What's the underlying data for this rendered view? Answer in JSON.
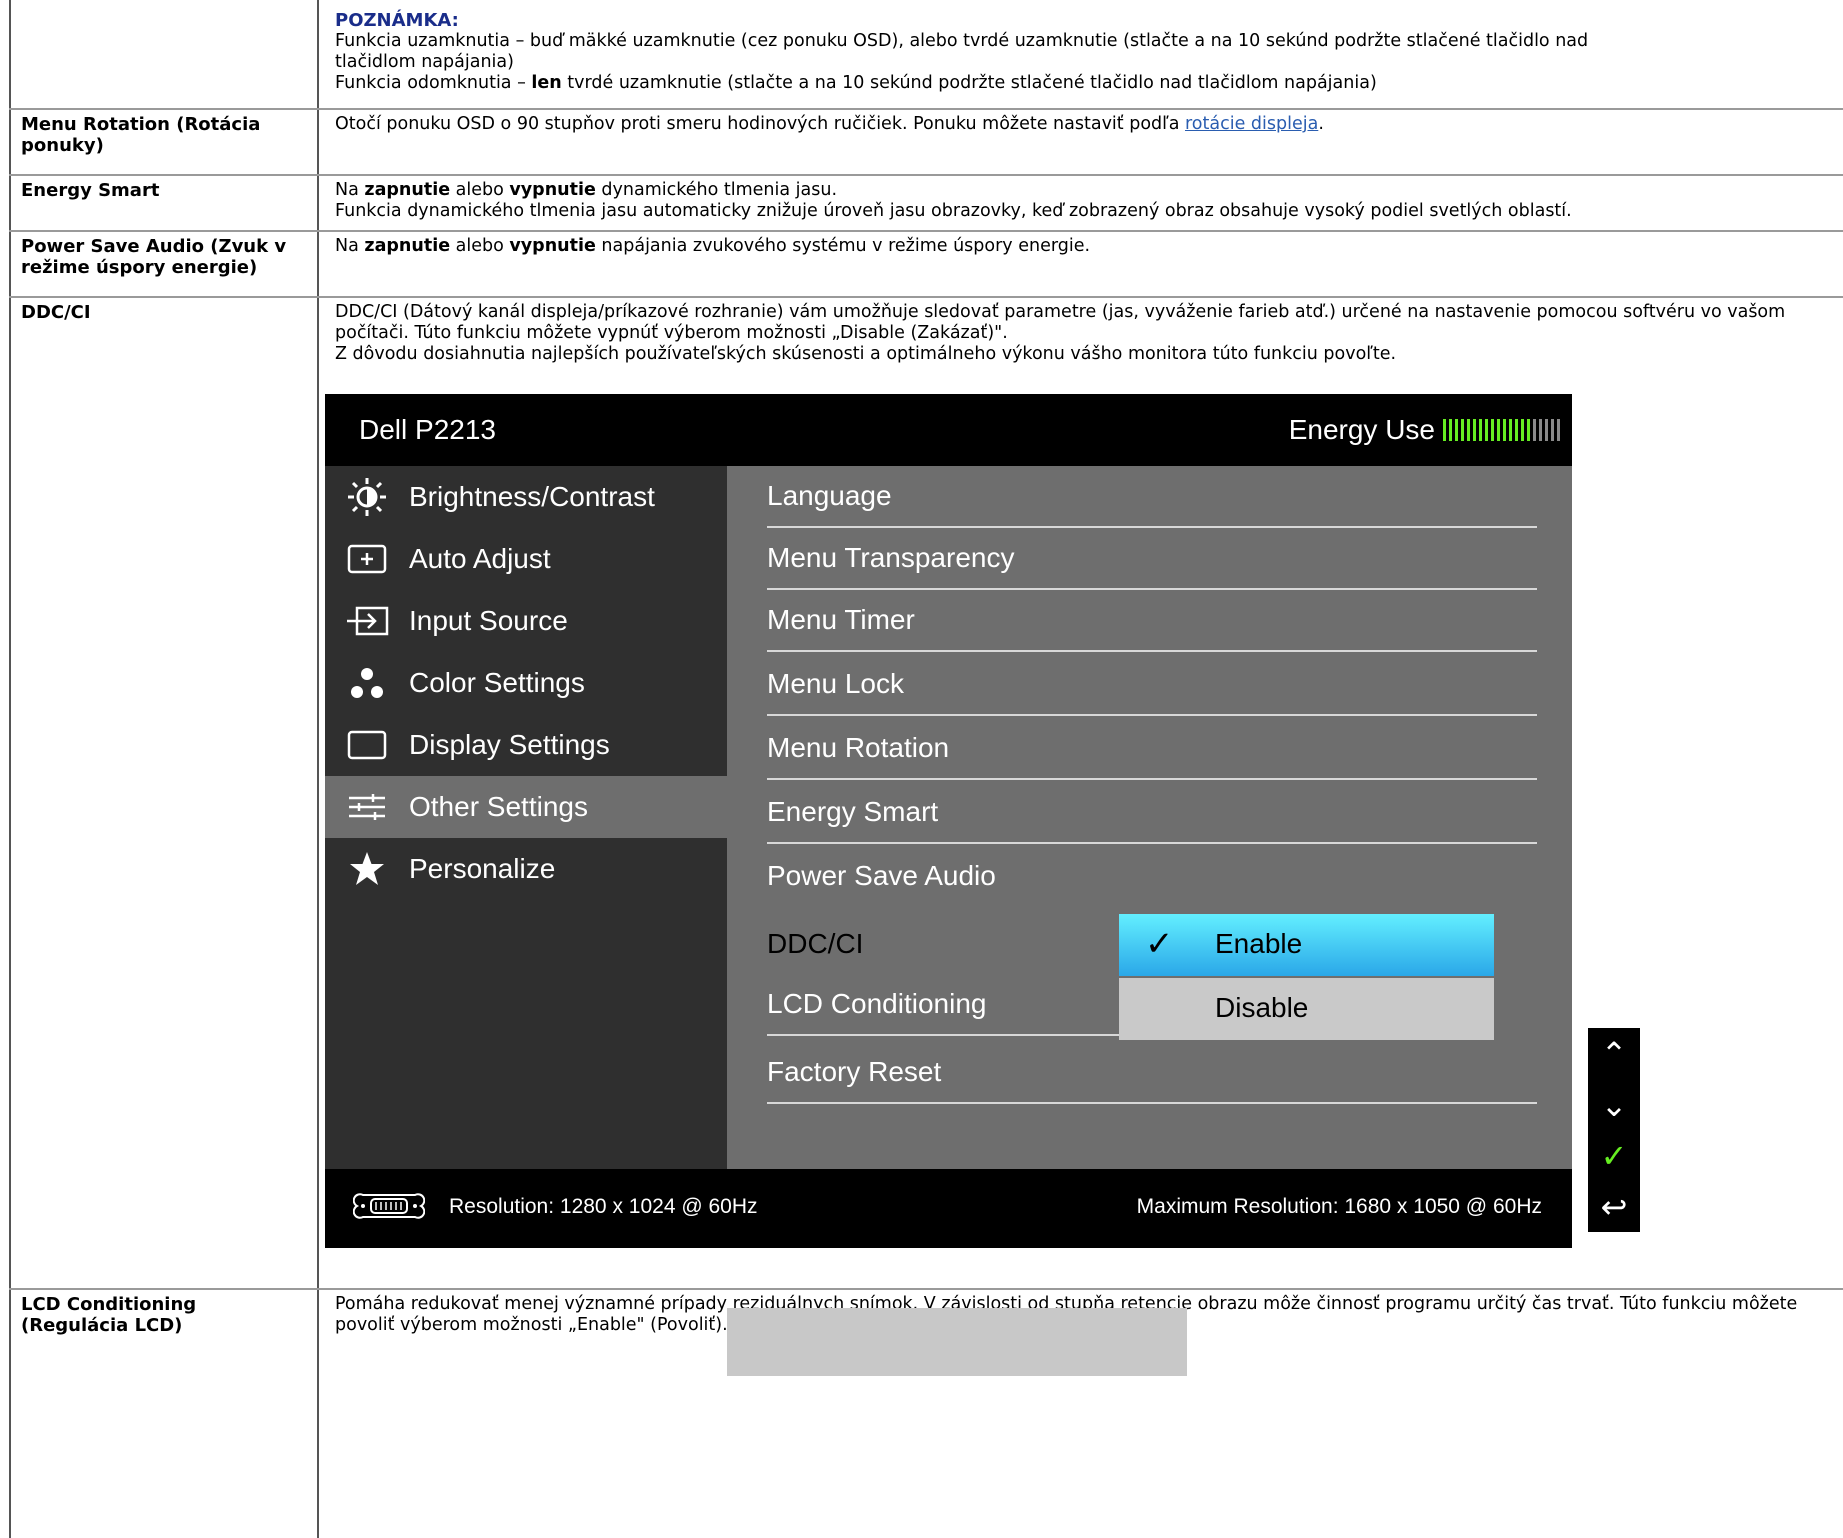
{
  "note": {
    "title": "POZNÁMKA:",
    "line1": "Funkcia uzamknutia – buď mäkké uzamknutie (cez ponuku OSD), alebo tvrdé uzamknutie (stlačte a na 10 sekúnd podržte stlačené tlačidlo nad",
    "line2": "tlačidlom napájania)",
    "line3_pre": "Funkcia odomknutia – ",
    "line3_bold": "len",
    "line3_post": " tvrdé uzamknutie (stlačte a na 10 sekúnd podržte stlačené tlačidlo nad tlačidlom napájania)"
  },
  "rows": {
    "menu_rotation": {
      "label": "Menu Rotation (Rotácia ponuky)",
      "text_pre": "Otočí ponuku OSD o 90 stupňov proti smeru hodinových ručičiek. Ponuku môžete nastaviť podľa ",
      "link": "rotácie displeja",
      "text_post": "."
    },
    "energy_smart": {
      "label": "Energy Smart",
      "l1_a": "Na ",
      "l1_b": "zapnutie",
      "l1_c": " alebo ",
      "l1_d": "vypnutie",
      "l1_e": " dynamického tlmenia jasu.",
      "l2": "Funkcia dynamického tlmenia jasu automaticky znižuje úroveň jasu obrazovky, keď zobrazený obraz obsahuje vysoký podiel svetlých oblastí."
    },
    "power_save_audio": {
      "label": "Power Save Audio (Zvuk v režime úspory energie)",
      "a": "Na ",
      "b": "zapnutie",
      "c": " alebo ",
      "d": "vypnutie",
      "e": " napájania zvukového systému v režime úspory energie."
    },
    "ddc_ci": {
      "label": "DDC/CI",
      "p1": "DDC/CI (Dátový kanál displeja/príkazové rozhranie) vám umožňuje sledovať parametre (jas, vyváženie farieb atď.) určené na nastavenie pomocou softvéru vo vašom počítači. Túto funkciu môžete vypnúť výberom možnosti „Disable (Zakázať)\".",
      "p2": "Z dôvodu dosiahnutia najlepších používateľských skúsenosti a optimálneho výkonu vášho monitora túto funkciu povoľte."
    },
    "lcd_conditioning": {
      "label": "LCD Conditioning (Regulácia LCD)",
      "text": "Pomáha redukovať menej významné prípady reziduálnych snímok. V závislosti od stupňa retencie obrazu môže činnosť programu určitý čas trvať. Túto funkciu môžete povoliť výberom možnosti „Enable\" (Povoliť)."
    }
  },
  "osd": {
    "title": "Dell P2213",
    "energy_label": "Energy Use",
    "energy_level": 0.75,
    "left_menu": [
      "Brightness/Contrast",
      "Auto Adjust",
      "Input Source",
      "Color Settings",
      "Display Settings",
      "Other Settings",
      "Personalize"
    ],
    "selected_left": "Other Settings",
    "right_menu": [
      "Language",
      "Menu Transparency",
      "Menu Timer",
      "Menu Lock",
      "Menu Rotation",
      "Energy Smart",
      "Power Save Audio",
      "DDC/CI",
      "LCD Conditioning",
      "Factory Reset"
    ],
    "options": {
      "enable": "Enable",
      "disable": "Disable"
    },
    "footer_resolution": "Resolution: 1280 x 1024 @ 60Hz",
    "footer_max": "Maximum Resolution: 1680 x 1050 @ 60Hz",
    "colors": {
      "accent_green": "#66ee22",
      "enable_cyan": "#4fd6f5"
    }
  }
}
